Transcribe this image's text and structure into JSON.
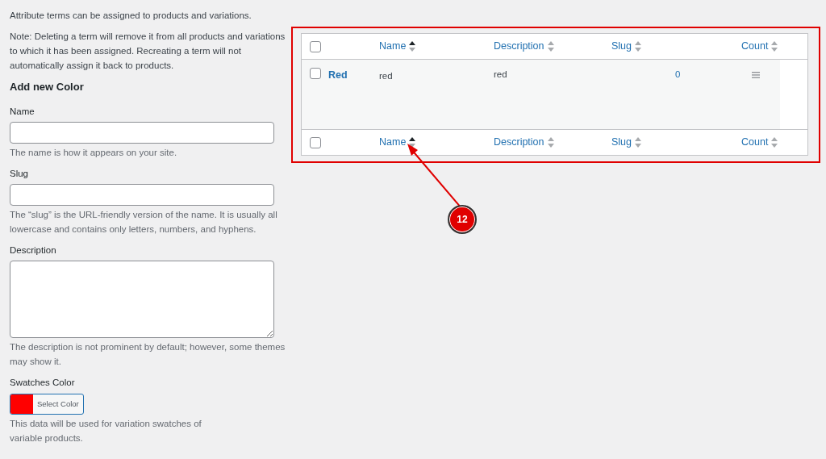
{
  "intro": [
    "Attribute terms can be assigned to products and variations.",
    "Note: Deleting a term will remove it from all products and variations to which it has been assigned. Recreating a term will not automatically assign it back to products."
  ],
  "form": {
    "title": "Add new Color",
    "fields": [
      {
        "kind": "input",
        "label": "Name",
        "help": "The name is how it appears on your site."
      },
      {
        "kind": "input",
        "label": "Slug",
        "help": "The “slug” is the URL-friendly version of the name. It is usually all lowercase and contains only letters, numbers, and hyphens."
      },
      {
        "kind": "textarea",
        "label": "Description",
        "help": "The description is not prominent by default; however, some themes may show it."
      },
      {
        "kind": "color",
        "label": "Swatches Color",
        "button": "Select Color",
        "color": "#ff0000",
        "help": "This data will be used for variation swatches of variable products."
      }
    ]
  },
  "table": {
    "header_select_all": {
      "checked": false
    },
    "footer_select_all": {
      "checked": false
    },
    "header": [
      {
        "label": "Name",
        "sorted": true
      },
      {
        "label": "Description",
        "sorted": false
      },
      {
        "label": "Slug",
        "sorted": false
      },
      {
        "label": "Count",
        "sorted": false
      }
    ],
    "rows": [
      {
        "checked": false,
        "title": "Red",
        "name": "red",
        "description": "red",
        "slug": "0"
      }
    ],
    "footer": [
      {
        "label": "Name",
        "sorted": true
      },
      {
        "label": "Description",
        "sorted": false
      },
      {
        "label": "Slug",
        "sorted": false
      },
      {
        "label": "Count",
        "sorted": false
      }
    ]
  },
  "annotation": {
    "label": "12"
  }
}
